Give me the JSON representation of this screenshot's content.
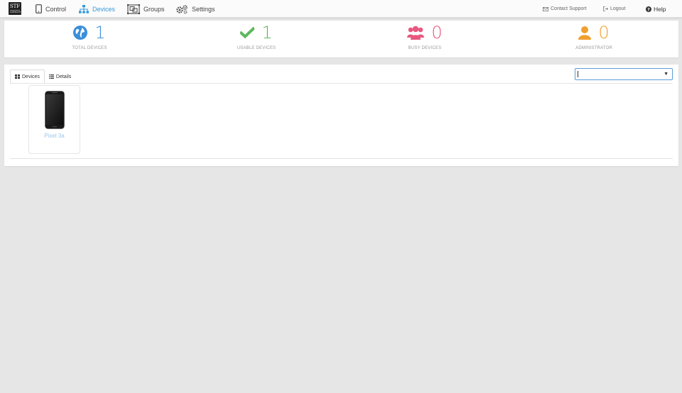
{
  "brand": {
    "logo_text": "STF",
    "logo_sub": "OPENSTF"
  },
  "nav": {
    "items": [
      {
        "label": "Control",
        "icon": "mobile-phone-icon"
      },
      {
        "label": "Devices",
        "icon": "sitemap-icon",
        "active": true
      },
      {
        "label": "Groups",
        "icon": "object-group-icon"
      },
      {
        "label": "Settings",
        "icon": "gears-icon"
      }
    ],
    "right": [
      {
        "label": "Contact Support",
        "icon": "envelope-icon"
      },
      {
        "label": "Logout",
        "icon": "sign-out-icon"
      },
      {
        "label": "Help",
        "icon": "question-circle-icon"
      }
    ]
  },
  "stats": [
    {
      "value": "1",
      "label": "TOTAL DEVICES",
      "icon": "globe-icon",
      "color": "#3b8fd9"
    },
    {
      "value": "1",
      "label": "USABLE DEVICES",
      "icon": "check-icon",
      "color": "#5cb85c"
    },
    {
      "value": "0",
      "label": "BUSY DEVICES",
      "icon": "users-icon",
      "color": "#e8577f"
    },
    {
      "value": "0",
      "label": "ADMINISTRATOR",
      "icon": "user-icon",
      "color": "#f0a030"
    }
  ],
  "tabs": [
    {
      "label": "Devices",
      "icon": "th-large-icon",
      "active": true
    },
    {
      "label": "Details",
      "icon": "list-icon"
    }
  ],
  "search": {
    "value": ""
  },
  "devices": [
    {
      "name": "Pixel 3a",
      "icon": "phone-image"
    }
  ],
  "colors": {
    "accent": "#3498db",
    "background": "#e6e6e6"
  }
}
